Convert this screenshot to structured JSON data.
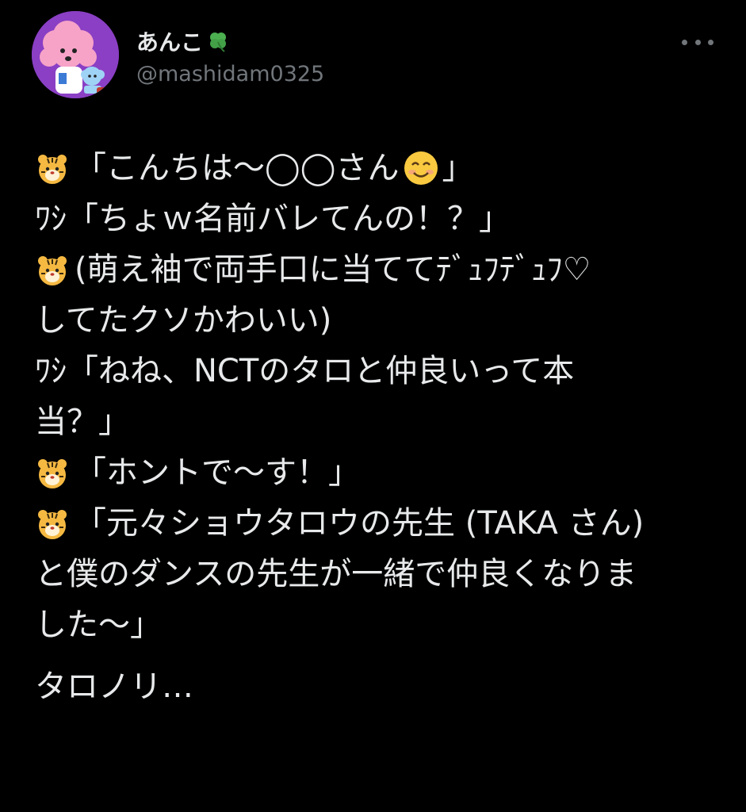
{
  "author": {
    "display_name": "あんこ",
    "name_emoji": "clover-icon",
    "handle": "@mashidam0325",
    "avatar": "avatar-pink-poodle-icon"
  },
  "colors": {
    "background": "#000000",
    "text": "#e7e9ea",
    "muted": "#71767b",
    "avatar_bg": "#8a3fc4"
  },
  "tweet": {
    "lines": [
      {
        "icon": "tiger-icon",
        "text_a": "「こんちは～◯◯さん",
        "emoji": "smile-icon",
        "text_b": "」"
      },
      {
        "text": "ﾜｼ「ちょｗ名前バレてんの！？」"
      },
      {
        "icon": "tiger-icon",
        "text": "(萌え袖で両手口に当ててﾃﾞｭﾌﾃﾞｭﾌ♡"
      },
      {
        "text": "してたクソかわいい)"
      },
      {
        "text": "ﾜｼ「ねね、NCTのタロと仲良いって本"
      },
      {
        "text": "当？」"
      },
      {
        "icon": "tiger-icon",
        "text": "「ホントで～す！」"
      },
      {
        "icon": "tiger-icon",
        "text": "「元々ショウタロウの先生 (TAKA さん)"
      },
      {
        "text": "と僕のダンスの先生が一緒で仲良くなりま"
      },
      {
        "text": "した～」"
      },
      {
        "text": "タロノリ…"
      }
    ]
  }
}
